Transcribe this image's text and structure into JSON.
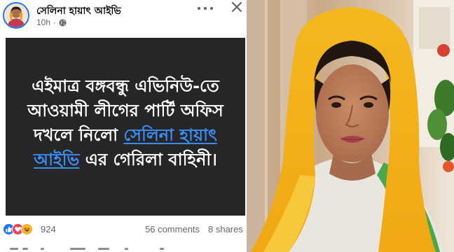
{
  "post": {
    "author": "সেলিনা হায়াৎ আইভি",
    "time": "10h",
    "separator": "·",
    "text_before": "এইমাত্র বঙ্গবন্ধু এভিনিউ-তে আওয়ামী লীগের পার্টি অফিস দখলে নিলো ",
    "mention": "সেলিনা হায়াৎ আইভি",
    "text_after": "  এর গেরিলা বাহিনী।",
    "card_color": "#262626",
    "mention_color": "#3b8cf6"
  },
  "stats": {
    "reaction_icons": [
      "like-icon",
      "love-icon",
      "haha-icon"
    ],
    "reaction_count": "924",
    "comments": "56 comments",
    "shares": "8 shares"
  },
  "photo": {
    "alt": "portrait-photo"
  }
}
